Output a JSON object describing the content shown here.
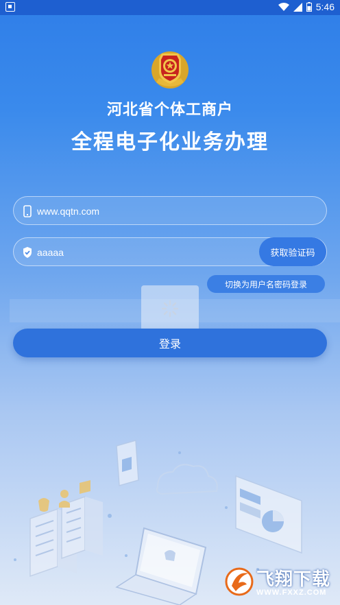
{
  "status_bar": {
    "time": "5:46"
  },
  "header": {
    "title_line1": "河北省个体工商户",
    "title_line2": "全程电子化业务办理"
  },
  "form": {
    "phone_value": "www.qqtn.com",
    "code_value": "aaaaa",
    "get_code_label": "获取验证码",
    "switch_label": "切换为用户名密码登录",
    "login_label": "登录"
  },
  "watermark": {
    "brand": "飞翔下载",
    "url": "WWW.FXXZ.COM"
  },
  "colors": {
    "primary": "#2f72dc",
    "status_bar": "#1e5fd0",
    "background_top": "#2f7ee8",
    "background_bottom": "#dfe9f7"
  }
}
